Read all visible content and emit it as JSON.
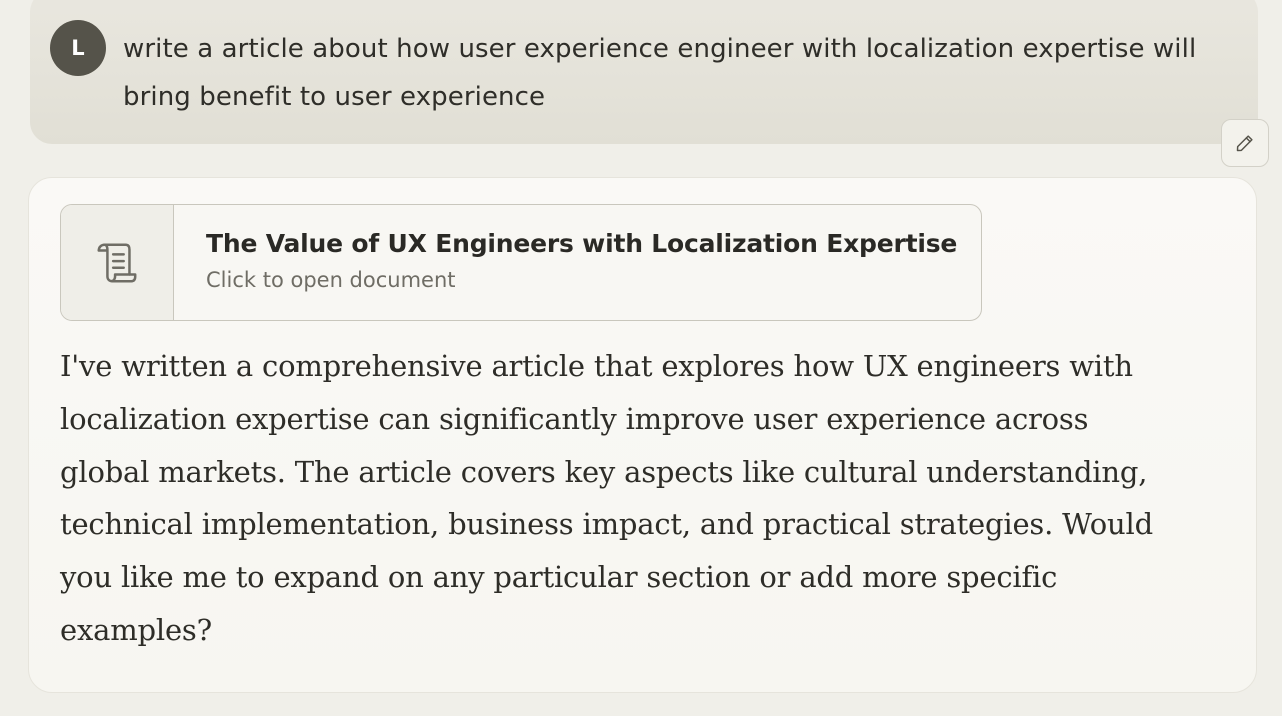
{
  "user_message": {
    "avatar_initial": "L",
    "text": "write a article about how user experience engineer with localization expertise will bring benefit to user experience"
  },
  "edit_button": {
    "icon": "pencil-icon"
  },
  "artifact": {
    "icon": "scroll-icon",
    "title": "The Value of UX Engineers with Localization Expertise",
    "subtitle": "Click to open document"
  },
  "assistant_message": {
    "text": "I've written a comprehensive article that explores how UX engineers with localization expertise can significantly improve user experience across global markets. The article covers key aspects like cultural understanding, technical implementation, business impact, and practical strategies. Would you like me to expand on any particular section or add more specific examples?"
  },
  "colors": {
    "background": "#f0efe9",
    "user_bubble": "#e4e2d9",
    "avatar": "#55534a",
    "text": "#2e2d28"
  }
}
